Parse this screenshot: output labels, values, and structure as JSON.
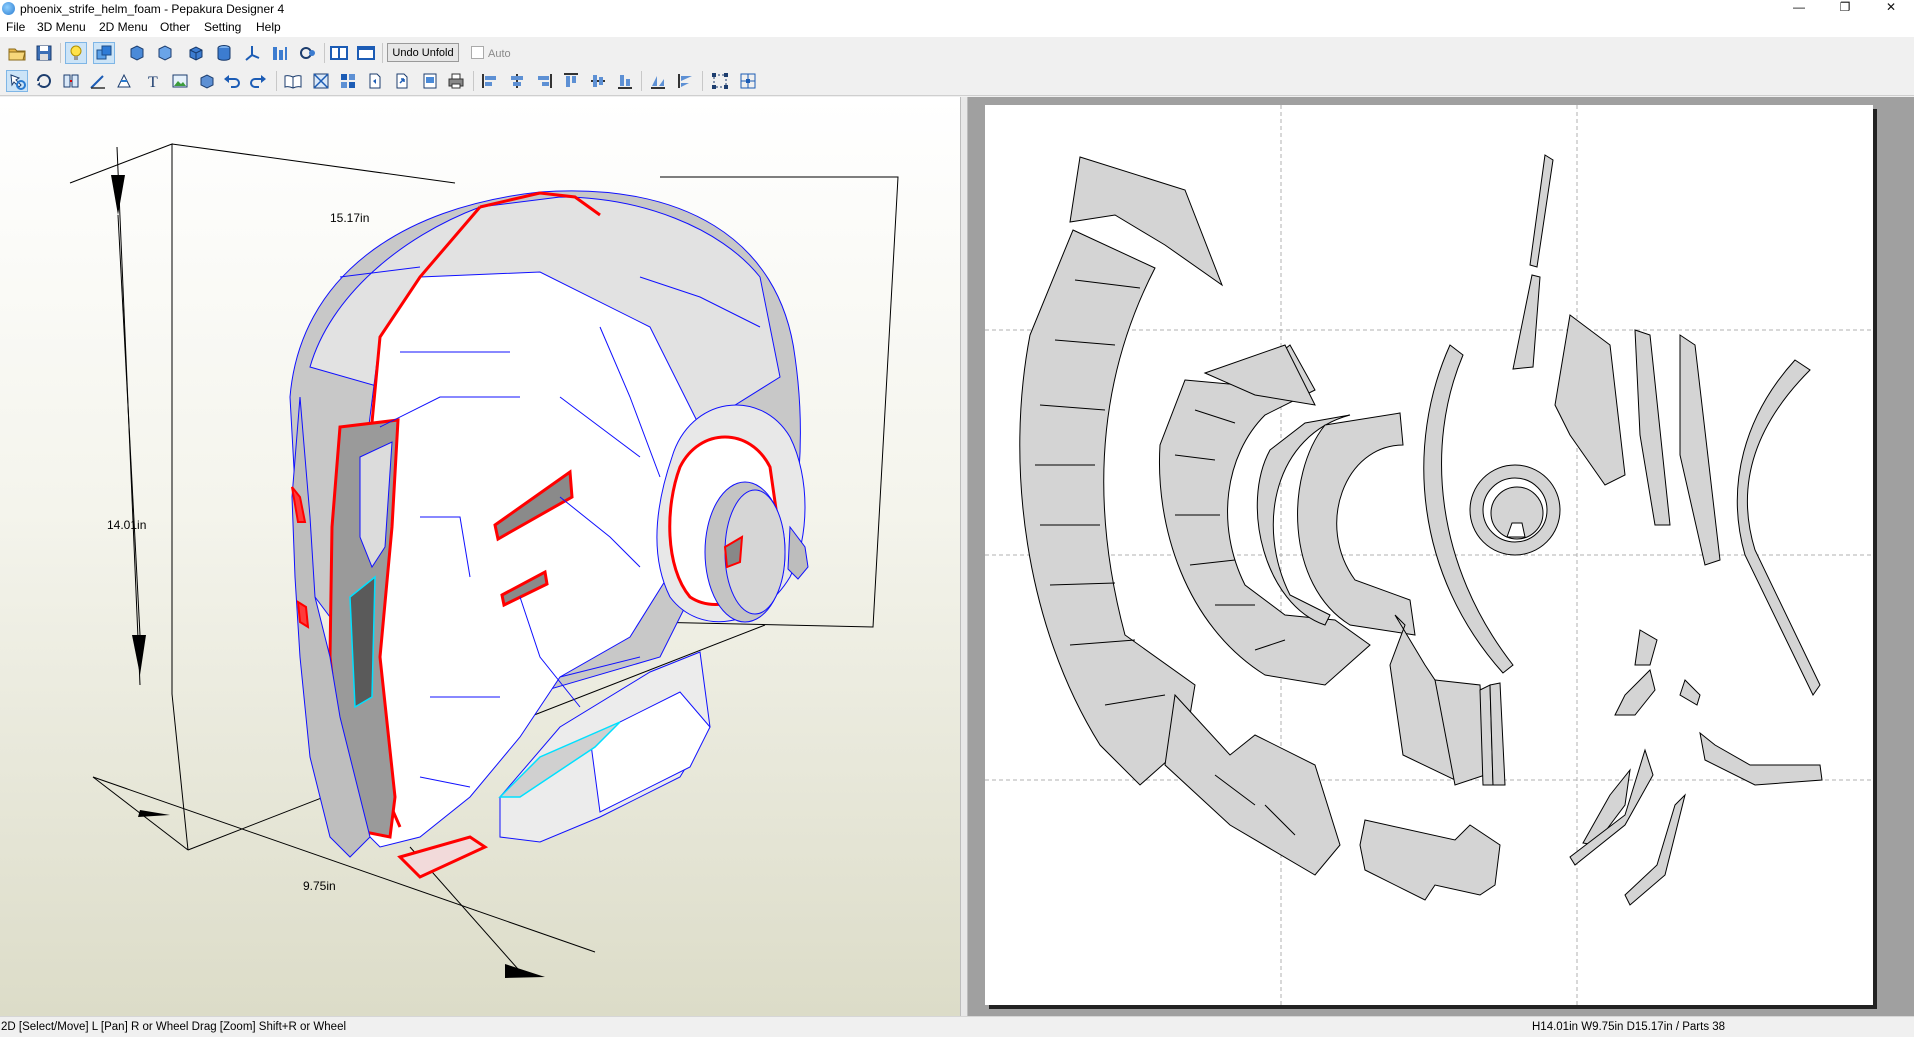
{
  "window": {
    "title": "phoenix_strife_helm_foam - Pepakura Designer 4",
    "minimize_glyph": "—",
    "restore_glyph": "❐",
    "close_glyph": "✕"
  },
  "menu": [
    "File",
    "3D Menu",
    "2D Menu",
    "Other",
    "Setting",
    "Help"
  ],
  "toolbar1": {
    "undo_unfold_label": "Undo Unfold",
    "auto_label": "Auto",
    "auto_checked": false
  },
  "view3d": {
    "dimensions": {
      "width": "15.17in",
      "height": "14.01in",
      "depth": "9.75in"
    }
  },
  "status": {
    "left": "2D [Select/Move] L [Pan] R or Wheel Drag [Zoom] Shift+R or Wheel",
    "right": "H14.01in W9.75in D15.17in / Parts 38"
  },
  "colors": {
    "cut_edge": "#ff0000",
    "fold_edge": "#0000ff",
    "glue_edge": "#00ffff",
    "part_fill": "#d4d4d4",
    "paper_background": "#a0a0a0"
  }
}
